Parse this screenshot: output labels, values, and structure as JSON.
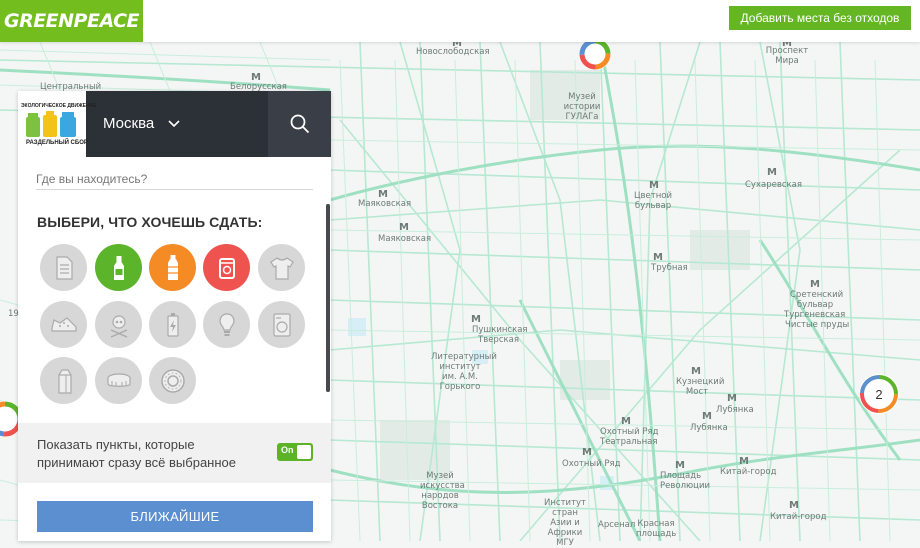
{
  "header": {
    "logo_text": "GREENPEACE",
    "add_button": "Добавить места без отходов"
  },
  "panel": {
    "logo_top": "ЭКОЛОГИЧЕСКОЕ ДВИЖЕНИЕ",
    "logo_bottom": "РАЗДЕЛЬНЫЙ СБОР",
    "city": "Москва",
    "location_placeholder": "Где вы находитесь?",
    "choose_title": "ВЫБЕРИ, ЧТО ХОЧЕШЬ СДАТЬ:",
    "categories": [
      {
        "name": "paper",
        "icon": "paper-icon",
        "active": false,
        "color": "#d7d7d7"
      },
      {
        "name": "glass",
        "icon": "glass-bottle-icon",
        "active": true,
        "color": "#5cb42b"
      },
      {
        "name": "plastic",
        "icon": "plastic-bottle-icon",
        "active": true,
        "color": "#f58b24"
      },
      {
        "name": "metal",
        "icon": "tin-can-icon",
        "active": true,
        "color": "#ef5350"
      },
      {
        "name": "clothes",
        "icon": "tshirt-icon",
        "active": false,
        "color": "#d7d7d7"
      },
      {
        "name": "shoes",
        "icon": "shoe-icon",
        "active": false,
        "color": "#d7d7d7"
      },
      {
        "name": "hazardous",
        "icon": "skull-icon",
        "active": false,
        "color": "#d7d7d7"
      },
      {
        "name": "batteries",
        "icon": "battery-icon",
        "active": false,
        "color": "#d7d7d7"
      },
      {
        "name": "lamps",
        "icon": "lightbulb-icon",
        "active": false,
        "color": "#d7d7d7"
      },
      {
        "name": "appliances",
        "icon": "washing-machine-icon",
        "active": false,
        "color": "#d7d7d7"
      },
      {
        "name": "tetrapak",
        "icon": "milk-carton-icon",
        "active": false,
        "color": "#d7d7d7"
      },
      {
        "name": "lids",
        "icon": "bottle-cap-icon",
        "active": false,
        "color": "#d7d7d7"
      },
      {
        "name": "tires",
        "icon": "tire-icon",
        "active": false,
        "color": "#d7d7d7"
      }
    ],
    "toggle_line1": "Показать пункты, которые",
    "toggle_line2": "принимают сразу всё выбранное",
    "toggle_label": "On",
    "toggle_on": true,
    "nearest_button": "БЛИЖАЙШИЕ"
  },
  "map": {
    "labels": [
      {
        "text": "Новослободская"
      },
      {
        "text": "Белорусская"
      },
      {
        "text": "Проспект Мира"
      },
      {
        "text": "Музей истории ГУЛАГа"
      },
      {
        "text": "Цветной бульвар"
      },
      {
        "text": "Сухаревская"
      },
      {
        "text": "Маяковская"
      },
      {
        "text": "Маяковская"
      },
      {
        "text": "Трубная"
      },
      {
        "text": "Сретенский бульвар"
      },
      {
        "text": "Тургеневская"
      },
      {
        "text": "Чистые пруды"
      },
      {
        "text": "Пушкинская"
      },
      {
        "text": "Тверская"
      },
      {
        "text": "Литературный институт им. А.М. Горького"
      },
      {
        "text": "Кузнецкий Мост"
      },
      {
        "text": "Лубянка"
      },
      {
        "text": "Лубянка"
      },
      {
        "text": "Охотный Ряд"
      },
      {
        "text": "Театральная"
      },
      {
        "text": "Охотный Ряд"
      },
      {
        "text": "Площадь Революции"
      },
      {
        "text": "Китай-город"
      },
      {
        "text": "Музей искусства народов Востока"
      },
      {
        "text": "Институт стран Азии и Африки МГУ"
      },
      {
        "text": "Арсенал"
      },
      {
        "text": "Красная площадь"
      },
      {
        "text": "Китай-город"
      },
      {
        "text": "Центральный"
      },
      {
        "text": "19"
      }
    ],
    "cluster_count": "2"
  }
}
